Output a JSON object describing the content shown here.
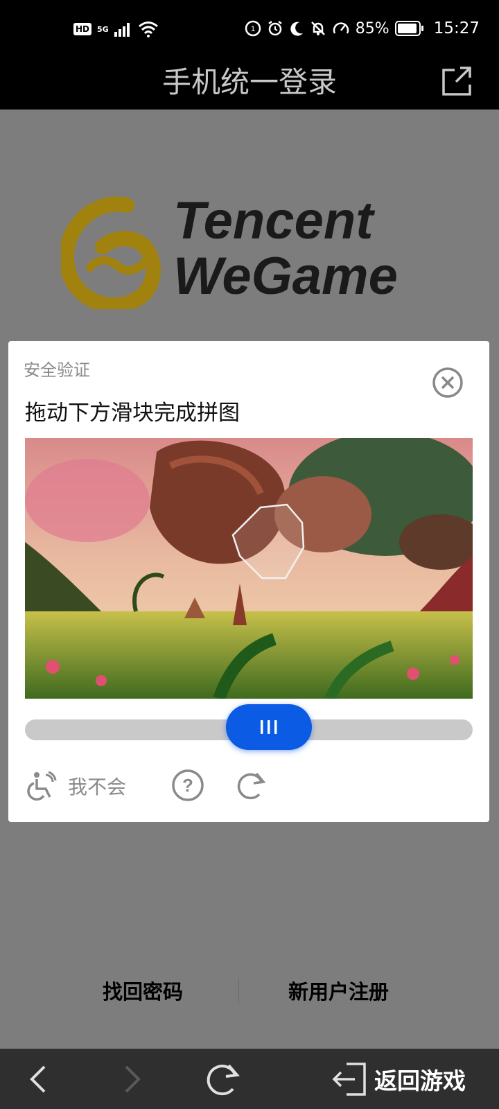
{
  "status_bar": {
    "network_badge": "HD",
    "network_type": "5G",
    "battery_percent": "85%",
    "time": "15:27"
  },
  "header": {
    "title": "手机统一登录",
    "share_icon": "share-icon"
  },
  "logo": {
    "brand_line1": "Tencent",
    "brand_line2": "WeGame",
    "brand_color": "#a2820f"
  },
  "captcha": {
    "subtitle": "安全验证",
    "instruction": "拖动下方滑块完成拼图",
    "close_icon": "close-icon",
    "slider_progress": 0.45,
    "accessibility_label": "我不会",
    "help_icon": "help-icon",
    "refresh_icon": "refresh-icon",
    "accent_color": "#0b5be5"
  },
  "links": {
    "recover_password": "找回密码",
    "register": "新用户注册"
  },
  "bottom_bar": {
    "back_to_game": "返回游戏"
  }
}
